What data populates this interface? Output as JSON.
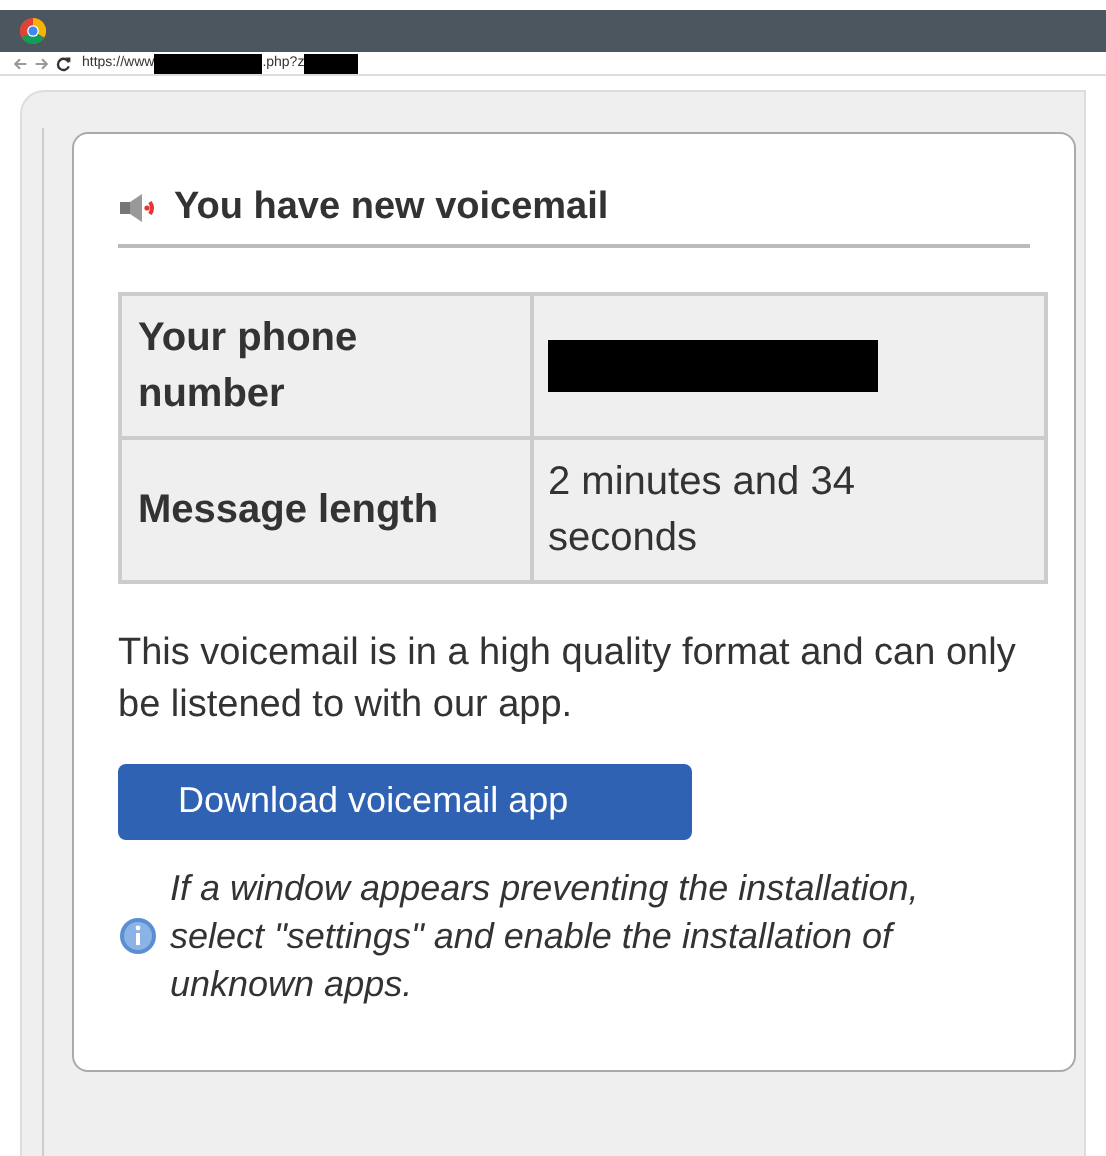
{
  "browser": {
    "address": [
      {
        "kind": "text",
        "text": "https://www"
      },
      {
        "kind": "redacted"
      },
      {
        "kind": "text",
        "text": ".php?z"
      },
      {
        "kind": "redacted"
      }
    ]
  },
  "card": {
    "title": "You have new voicemail",
    "table": [
      {
        "label": "Your phone number",
        "value_redacted": true
      },
      {
        "label": "Message length",
        "value": "2 minutes and 34 seconds",
        "value_redacted": false
      }
    ],
    "message": "This voicemail is in a high quality format and can only be listened to with our app.",
    "button": "Download voicemail app",
    "note": "If a window appears preventing the installation, select \"settings\" and enable the installation of unknown apps."
  }
}
